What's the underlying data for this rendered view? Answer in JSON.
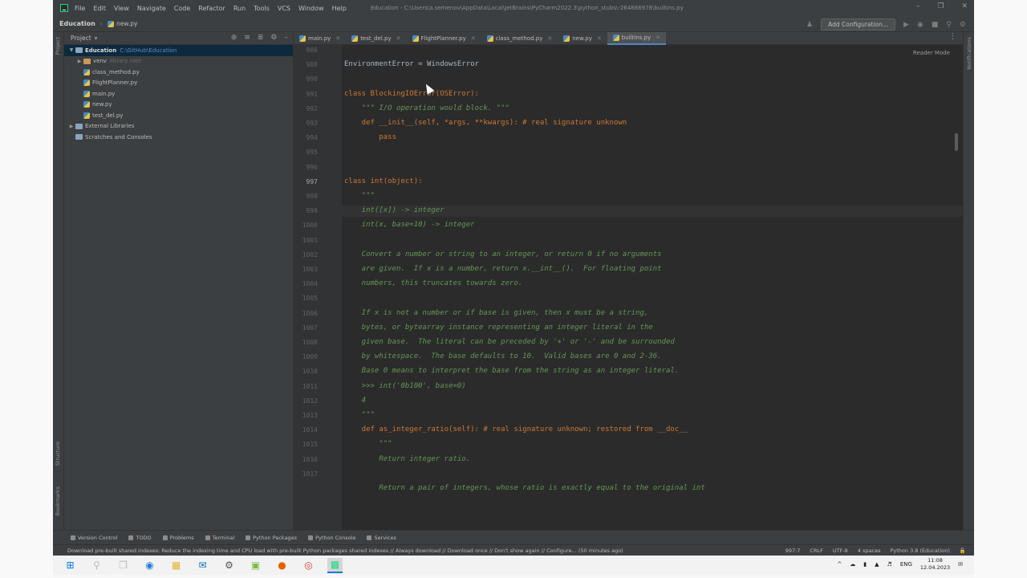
{
  "window": {
    "title": "Education - C:\\Users\\a.semenov\\AppData\\Local\\JetBrains\\PyCharm2022.3\\python_stubs\\-264886978\\builtins.py",
    "menu": [
      "File",
      "Edit",
      "View",
      "Navigate",
      "Code",
      "Refactor",
      "Run",
      "Tools",
      "VCS",
      "Window",
      "Help"
    ]
  },
  "navbar": {
    "project": "Education",
    "file": "new.py",
    "add_config": "Add Configuration..."
  },
  "stripes": {
    "project": "Project",
    "structure": "Structure",
    "bookmarks": "Bookmarks",
    "notifications": "Notifications"
  },
  "project_panel": {
    "title": "Project",
    "root": "Education",
    "root_path": "C:\\GitHub\\Education",
    "venv": "venv",
    "venv_note": "library root",
    "files": [
      "class_method.py",
      "FlightPlanner.py",
      "main.py",
      "new.py",
      "test_del.py"
    ],
    "external": "External Libraries",
    "scratches": "Scratches and Consoles"
  },
  "tabs": [
    "main.py",
    "test_del.py",
    "FlightPlanner.py",
    "class_method.py",
    "new.py",
    "builtins.py"
  ],
  "editor": {
    "reader_mode": "Reader Mode",
    "lines": [
      {
        "n": "986",
        "text": ""
      },
      {
        "n": "988",
        "text": "EnvironmentError = WindowsError"
      },
      {
        "n": "990",
        "text": ""
      },
      {
        "n": "991",
        "text": "class BlockingIOError(OSError):"
      },
      {
        "n": "992",
        "text": "    \"\"\" I/O operation would block. \"\"\""
      },
      {
        "n": "993",
        "text": "    def __init__(self, *args, **kwargs): # real signature unknown"
      },
      {
        "n": "994",
        "text": "        pass"
      },
      {
        "n": "995",
        "text": ""
      },
      {
        "n": "996",
        "text": ""
      },
      {
        "n": "997",
        "text": "class int(object):"
      },
      {
        "n": "998",
        "text": "    \"\"\""
      },
      {
        "n": "999",
        "text": "    int([x]) -> integer"
      },
      {
        "n": "1000",
        "text": "    int(x, base=10) -> integer"
      },
      {
        "n": "1001",
        "text": ""
      },
      {
        "n": "1002",
        "text": "    Convert a number or string to an integer, or return 0 if no arguments"
      },
      {
        "n": "1003",
        "text": "    are given.  If x is a number, return x.__int__().  For floating point"
      },
      {
        "n": "1004",
        "text": "    numbers, this truncates towards zero."
      },
      {
        "n": "1005",
        "text": ""
      },
      {
        "n": "1006",
        "text": "    If x is not a number or if base is given, then x must be a string,"
      },
      {
        "n": "1007",
        "text": "    bytes, or bytearray instance representing an integer literal in the"
      },
      {
        "n": "1008",
        "text": "    given base.  The literal can be preceded by '+' or '-' and be surrounded"
      },
      {
        "n": "1009",
        "text": "    by whitespace.  The base defaults to 10.  Valid bases are 0 and 2-36."
      },
      {
        "n": "1010",
        "text": "    Base 0 means to interpret the base from the string as an integer literal."
      },
      {
        "n": "1011",
        "text": "    >>> int('0b100', base=0)"
      },
      {
        "n": "1012",
        "text": "    4"
      },
      {
        "n": "1013",
        "text": "    \"\"\""
      },
      {
        "n": "1014",
        "text": "    def as_integer_ratio(self): # real signature unknown; restored from __doc__"
      },
      {
        "n": "1015",
        "text": "        \"\"\""
      },
      {
        "n": "1016",
        "text": "        Return integer ratio."
      },
      {
        "n": "1017",
        "text": ""
      },
      {
        "n": "",
        "text": "        Return a pair of integers, whose ratio is exactly equal to the original int"
      }
    ],
    "breadcrumb": "int"
  },
  "bottom_tools": [
    "Version Control",
    "TODO",
    "Problems",
    "Terminal",
    "Python Packages",
    "Python Console",
    "Services"
  ],
  "status": {
    "message": "Download pre-built shared indexes: Reduce the indexing time and CPU load with pre-built Python packages shared indexes // Always download // Download once // Don't show again // Configure... (50 minutes ago)",
    "position": "997:7",
    "line_sep": "CRLF",
    "encoding": "UTF-8",
    "indent": "4 spaces",
    "interpreter": "Python 3.8 (Education)"
  },
  "taskbar": {
    "lang": "ENG",
    "time": "11:08",
    "date": "12.04.2023"
  }
}
